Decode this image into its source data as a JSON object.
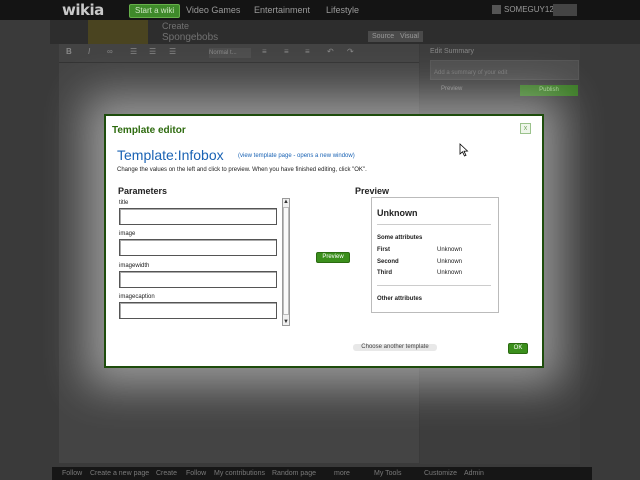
{
  "nav": {
    "logo": "wikia",
    "start_wiki": "Start a wiki",
    "links": [
      "Video Games",
      "Entertainment",
      "Lifestyle"
    ],
    "user": "SOMEGUY123"
  },
  "page": {
    "wiki_name": "Create",
    "page_name": "Spongebobs",
    "tabs": [
      "Source",
      "Visual"
    ],
    "font_select": "Normal t...",
    "summary_label": "Edit Summary",
    "summary_placeholder": "Add a summary of your edit",
    "preview": "Preview",
    "publish": "Publish"
  },
  "footer": {
    "links": [
      "Follow",
      "Create a new page",
      "Create",
      "Follow",
      "My contributions",
      "Random page",
      "more",
      "My Tools",
      "Customize",
      "Admin"
    ]
  },
  "modal": {
    "title": "Template editor",
    "close": "x",
    "template_name": "Template:Infobox",
    "template_link": "(view template page - opens a new window)",
    "instructions": "Change the values on the left and click to preview. When you have finished editing, click \"OK\".",
    "parameters_heading": "Parameters",
    "preview_heading": "Preview",
    "params": [
      {
        "label": "title",
        "value": ""
      },
      {
        "label": "image",
        "value": ""
      },
      {
        "label": "imagewidth",
        "value": ""
      },
      {
        "label": "imagecaption",
        "value": ""
      }
    ],
    "preview_button": "Preview",
    "infobox": {
      "title": "Unknown",
      "section1": "Some attributes",
      "rows": [
        {
          "k": "First",
          "v": "Unknown"
        },
        {
          "k": "Second",
          "v": "Unknown"
        },
        {
          "k": "Third",
          "v": "Unknown"
        }
      ],
      "section2": "Other attributes"
    },
    "choose_another": "Choose another template",
    "ok": "OK"
  }
}
